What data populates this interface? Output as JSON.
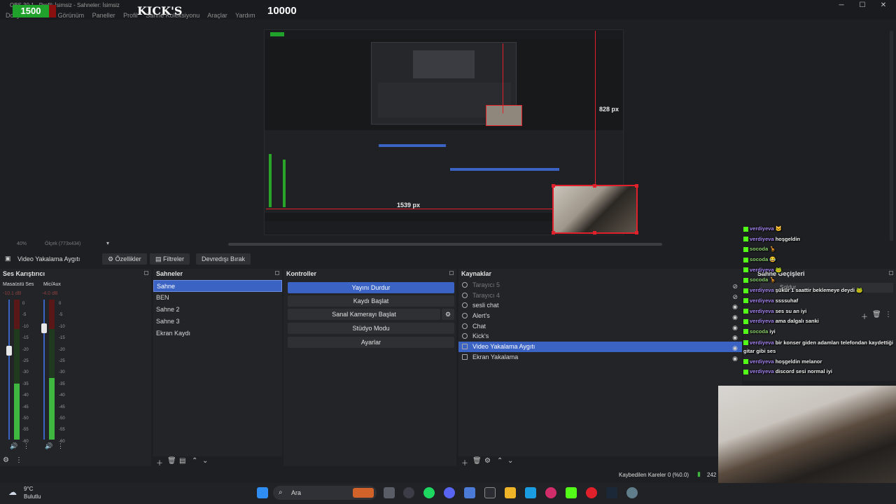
{
  "window": {
    "title": "OBS 30.1 - Profil: İsimsiz - Sahneler: İsimsiz",
    "menu": [
      "Dosya",
      "Düzen",
      "Görünüm",
      "Paneller",
      "Profil",
      "Sahne Koleksiyonu",
      "Araçlar",
      "Yardım"
    ],
    "controls": {
      "minimize": "─",
      "maximize": "☐",
      "close": "✕"
    }
  },
  "overlay": {
    "counter": "1500",
    "title": "KICK'S",
    "goal": "10000"
  },
  "preview": {
    "width_label": "1539 px",
    "height_label": "828 px"
  },
  "zoom": {
    "zoom_label": "40%",
    "scale_label": "Ölçek (773x434)"
  },
  "source_toolbar": {
    "selected_source": "Video Yakalama Aygıtı",
    "properties": "Özellikler",
    "filters": "Filtreler",
    "deactivate": "Devredışı Bırak"
  },
  "mixer": {
    "title": "Ses Karıştırıcı",
    "channels": [
      {
        "name": "Masaüstü Ses",
        "db": "-10.1 dB",
        "level": 0.6
      },
      {
        "name": "Mic/Aux",
        "db": "-4.0 dB",
        "level": 0.7
      }
    ],
    "scale": [
      "0",
      "-5",
      "-10",
      "-15",
      "-20",
      "-25",
      "-30",
      "-35",
      "-40",
      "-45",
      "-50",
      "-55",
      "-60"
    ]
  },
  "scenes": {
    "title": "Sahneler",
    "items": [
      "Sahne",
      "BEN",
      "Sahne 2",
      "Sahne 3",
      "Ekran Kaydı"
    ],
    "selected_index": 0
  },
  "controls": {
    "title": "Kontroller",
    "stop_stream": "Yayını Durdur",
    "start_recording": "Kaydı Başlat",
    "virtual_camera": "Sanal Kamerayı Başlat",
    "studio_mode": "Stüdyo Modu",
    "settings": "Ayarlar"
  },
  "sources": {
    "title": "Kaynaklar",
    "items": [
      {
        "name": "Tarayıcı 5",
        "dim": true
      },
      {
        "name": "Tarayıcı 4",
        "dim": true
      },
      {
        "name": "sesli chat",
        "dim": false
      },
      {
        "name": "Alert's",
        "dim": false
      },
      {
        "name": "Chat",
        "dim": false
      },
      {
        "name": "Kick's",
        "dim": false
      },
      {
        "name": "Video Yakalama Aygıtı",
        "dim": false,
        "selected": true
      },
      {
        "name": "Ekran Yakalama",
        "dim": false
      }
    ]
  },
  "transitions": {
    "title": "Sahne Geçişleri",
    "type": "Soldur"
  },
  "chat": [
    {
      "user": "verdiyeva",
      "msg": "🐱",
      "color": "purple"
    },
    {
      "user": "verdiyeva",
      "msg": "hoşgeldin",
      "color": "purple"
    },
    {
      "user": "socoda",
      "msg": "🦒",
      "color": "green"
    },
    {
      "user": "socoda",
      "msg": "😂",
      "color": "green"
    },
    {
      "user": "verdiyeva",
      "msg": "🐸",
      "color": "purple"
    },
    {
      "user": "socoda",
      "msg": "🦒",
      "color": "green"
    },
    {
      "user": "verdiyeva",
      "msg": "şükür 1 saattir beklemeye deydi 🐸",
      "color": "purple"
    },
    {
      "user": "verdiyeva",
      "msg": "ssssuhaf",
      "color": "purple"
    },
    {
      "user": "verdiyeva",
      "msg": "ses su an iyi",
      "color": "purple"
    },
    {
      "user": "verdiyeva",
      "msg": "ama dalgalı sanki",
      "color": "purple"
    },
    {
      "user": "socoda",
      "msg": "iyi",
      "color": "green"
    },
    {
      "user": "verdiyeva",
      "msg": "bir konser giden adamları telefondan kaydettiği gitar gibi ses",
      "color": "purple"
    },
    {
      "user": "verdiyeva",
      "msg": "hoşgeldin melanor",
      "color": "purple"
    },
    {
      "user": "verdiyeva",
      "msg": "discord sesi normal iyi",
      "color": "purple"
    }
  ],
  "status": {
    "dropped_frames": "Kaybedilen Kareler 0 (%0.0)",
    "bitrate": "242"
  },
  "taskbar": {
    "temp": "9°C",
    "weather": "Bulutlu",
    "search": "Ara"
  },
  "colors": {
    "accent": "#3a63c4",
    "live_red": "#e0202a",
    "kick_green": "#53fc18"
  }
}
